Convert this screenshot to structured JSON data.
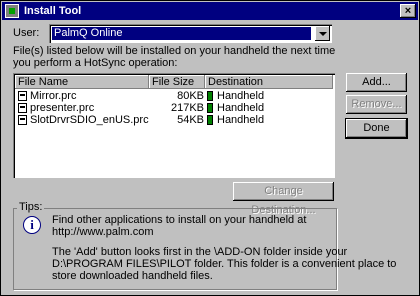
{
  "window": {
    "title": "Install Tool",
    "close_glyph": "×"
  },
  "user": {
    "label": "User:",
    "selected": "PalmQ Online"
  },
  "info": {
    "line1": "File(s) listed below will be installed on your handheld the next time",
    "line2": "you perform a HotSync operation:"
  },
  "list": {
    "columns": [
      "File Name",
      "File Size",
      "Destination"
    ],
    "rows": [
      {
        "name": "Mirror.prc",
        "size": "80KB",
        "dest": "Handheld"
      },
      {
        "name": "presenter.prc",
        "size": "217KB",
        "dest": "Handheld"
      },
      {
        "name": "SlotDrvrSDIO_enUS.prc",
        "size": "54KB",
        "dest": "Handheld"
      }
    ]
  },
  "buttons": {
    "add": "Add...",
    "remove": "Remove...",
    "done": "Done",
    "change_destination": "Change Destination..."
  },
  "tips": {
    "label": "Tips:",
    "line1": "Find other applications to install on your handheld at",
    "line2": "http://www.palm.com",
    "line3": "The 'Add' button looks first in the \\ADD-ON folder inside your",
    "line4": "D:\\PROGRAM FILES\\PILOT folder. This folder is a convenient place to",
    "line5": "store downloaded handheld files."
  },
  "colors": {
    "titlebar": "#000080",
    "selection": "#000080",
    "face": "#c0c0c0",
    "dest_icon": "#008000"
  }
}
